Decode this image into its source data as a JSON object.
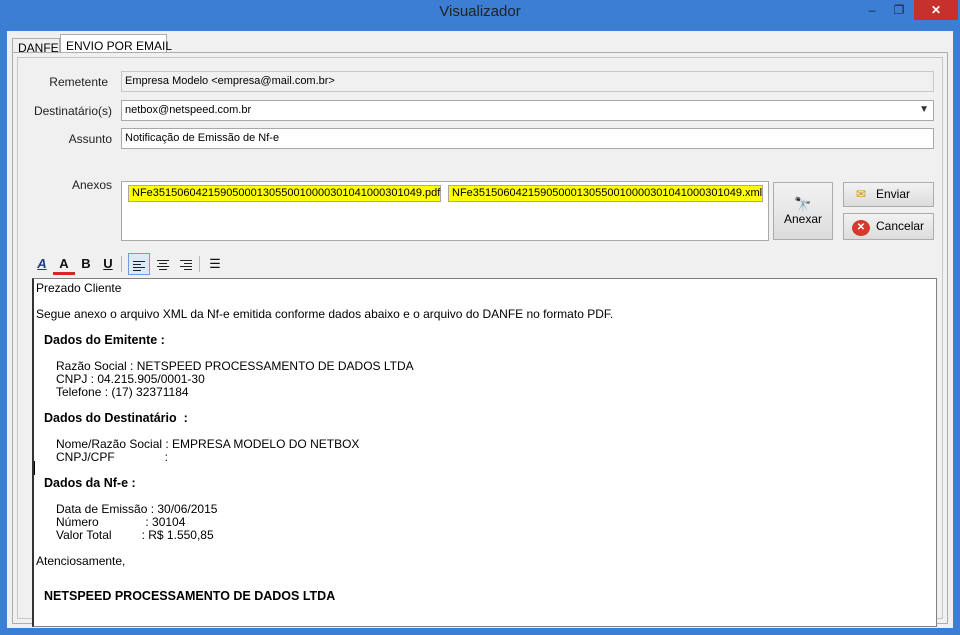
{
  "window": {
    "title": "Visualizador",
    "minimize": "–",
    "maximize": "❐",
    "close": "✕"
  },
  "tabs": [
    {
      "label": "DANFE"
    },
    {
      "label": "ENVIO POR EMAIL"
    }
  ],
  "form": {
    "remetente_label": "Remetente",
    "remetente_value": "Empresa Modelo <empresa@mail.com.br>",
    "destinatario_label": "Destinatário(s)",
    "destinatario_value": "netbox@netspeed.com.br",
    "assunto_label": "Assunto",
    "assunto_value": "Notificação de Emissão de Nf-e",
    "anexos_label": "Anexos"
  },
  "attachments": [
    {
      "name": "NFe35150604215905000130550010000301041000301049.pdf"
    },
    {
      "name": "NFe35150604215905000130550010000301041000301049.xml"
    }
  ],
  "buttons": {
    "anexar": "Anexar",
    "enviar": "Enviar",
    "cancelar": "Cancelar"
  },
  "toolbar_icons": [
    "font-icon",
    "font-color-icon",
    "bold-icon",
    "underline-icon",
    "align-left-icon",
    "align-center-icon",
    "align-right-icon",
    "bullet-list-icon"
  ],
  "toolbar_glyphs": {
    "font": "A",
    "font_color": "A",
    "bold": "B",
    "underline": "U"
  },
  "colors": {
    "highlight": "#ffff00",
    "titlebar": "#3b7ed4",
    "close": "#c7312c"
  },
  "body_lines": {
    "greeting": "Prezado Cliente",
    "intro": "Segue anexo o arquivo XML da Nf-e emitida conforme dados abaixo e o arquivo do DANFE no formato PDF.",
    "emitente_header": "Dados do Emitente :",
    "emitente_razao": "Razão Social : NETSPEED PROCESSAMENTO DE DADOS LTDA",
    "emitente_cnpj": "CNPJ : 04.215.905/0001-30",
    "emitente_telefone": "Telefone : (17) 32371184",
    "destinatario_header": "Dados do Destinatário  :",
    "destinatario_nome": "Nome/Razão Social : EMPRESA MODELO DO NETBOX",
    "destinatario_cnpj": "CNPJ/CPF               :",
    "nfe_header": "Dados da Nf-e :",
    "nfe_data": "Data de Emissão : 30/06/2015",
    "nfe_numero": "Número              : 30104",
    "nfe_valor": "Valor Total         : R$ 1.550,85",
    "closing": "Atenciosamente,",
    "signature": "NETSPEED PROCESSAMENTO DE DADOS LTDA"
  }
}
